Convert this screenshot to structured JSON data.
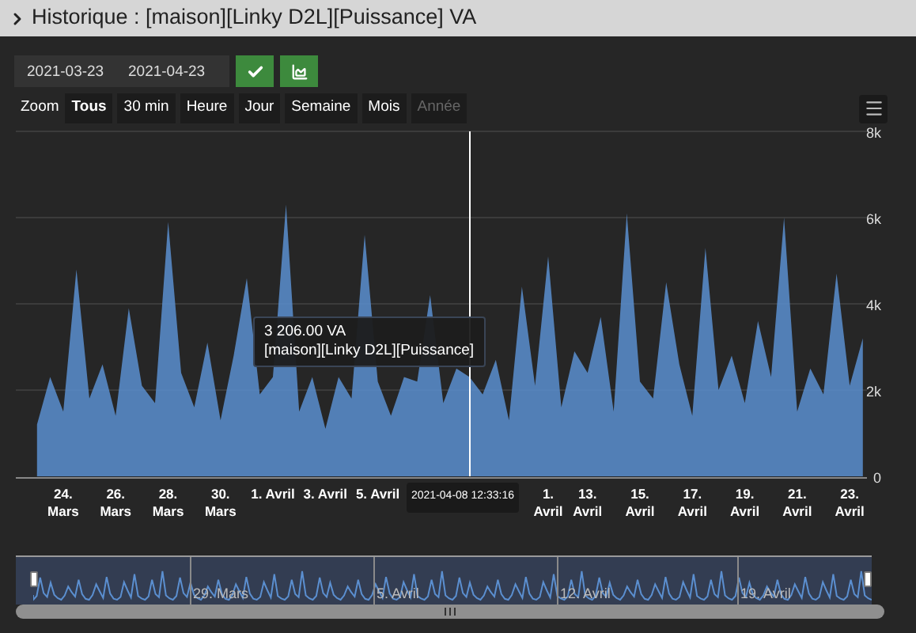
{
  "window": {
    "title": "Historique : [maison][Linky D2L][Puissance] VA"
  },
  "date_range": {
    "start": "2021-03-23",
    "end": "2021-04-23"
  },
  "zoom": {
    "label": "Zoom",
    "buttons": [
      {
        "label": "Tous",
        "selected": true,
        "disabled": false
      },
      {
        "label": "30 min",
        "selected": false,
        "disabled": false
      },
      {
        "label": "Heure",
        "selected": false,
        "disabled": false
      },
      {
        "label": "Jour",
        "selected": false,
        "disabled": false
      },
      {
        "label": "Semaine",
        "selected": false,
        "disabled": false
      },
      {
        "label": "Mois",
        "selected": false,
        "disabled": false
      },
      {
        "label": "Année",
        "selected": false,
        "disabled": true
      }
    ]
  },
  "chart": {
    "chart_data": {
      "type": "area",
      "ylim": [
        0,
        8000
      ],
      "yticks": [
        {
          "value": 0,
          "label": "0"
        },
        {
          "value": 2000,
          "label": "2k"
        },
        {
          "value": 4000,
          "label": "4k"
        },
        {
          "value": 6000,
          "label": "6k"
        },
        {
          "value": 8000,
          "label": "8k"
        }
      ],
      "grid": true,
      "categories": [
        null,
        null,
        "24.\nMars",
        null,
        null,
        null,
        "26.\nMars",
        null,
        null,
        null,
        "28.\nMars",
        null,
        null,
        null,
        "30.\nMars",
        null,
        null,
        null,
        "1. Avril",
        null,
        null,
        null,
        "3. Avril",
        null,
        null,
        null,
        "5. Avril",
        null,
        null,
        null,
        null,
        null,
        null,
        null,
        null,
        null,
        null,
        null,
        null,
        "1.\nAvril",
        null,
        null,
        "13.\nAvril",
        null,
        null,
        null,
        "15.\nAvril",
        null,
        null,
        null,
        "17.\nAvril",
        null,
        null,
        null,
        "19.\nAvril",
        null,
        null,
        null,
        "21.\nAvril",
        null,
        null,
        null,
        "23.\nAvril",
        null
      ],
      "series": [
        {
          "name": "[maison][Linky D2L][Puissance]",
          "color": "#5b8fd0",
          "values": [
            1200,
            2300,
            1500,
            4800,
            1800,
            2600,
            1400,
            3900,
            2100,
            1700,
            5900,
            2400,
            1600,
            3100,
            1300,
            2800,
            4600,
            1900,
            2300,
            6300,
            1500,
            2300,
            1100,
            2300,
            1800,
            5600,
            2200,
            1400,
            2300,
            2200,
            4200,
            1700,
            2500,
            2300,
            1900,
            2700,
            1300,
            4400,
            2100,
            5100,
            1600,
            2900,
            2400,
            3700,
            1500,
            6100,
            2200,
            1800,
            4500,
            2600,
            1400,
            5300,
            2000,
            2800,
            1700,
            3600,
            2300,
            6000,
            1500,
            2500,
            1900,
            4700,
            2100,
            3200
          ]
        }
      ]
    },
    "tooltip": {
      "value": "3 206.00 VA"
    },
    "crosshair_label": "2021-04-08 12:33:16"
  },
  "navigator": {
    "labels": [
      "29. Mars",
      "5. Avril",
      "12. Avril",
      "19. Avril"
    ]
  }
}
